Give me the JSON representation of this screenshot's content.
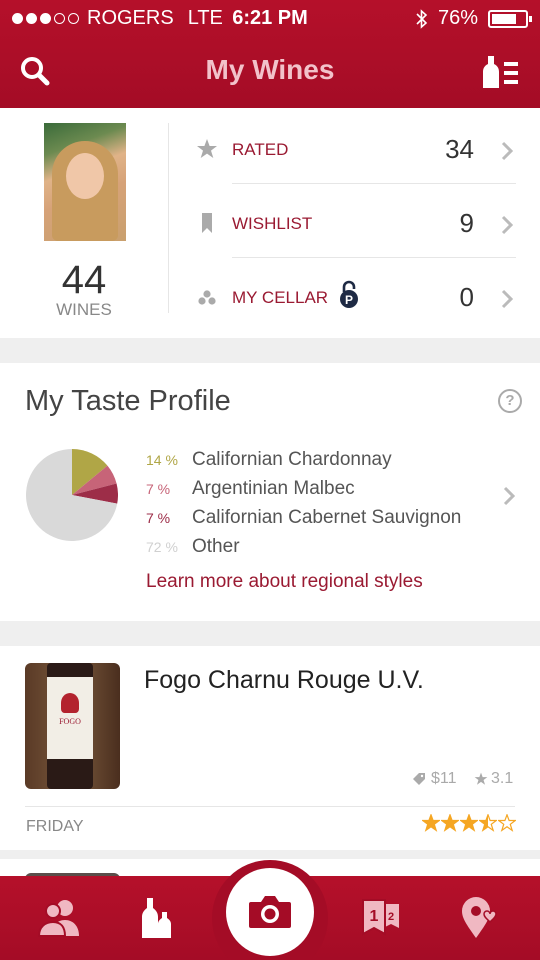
{
  "status_bar": {
    "carrier": "ROGERS",
    "network": "LTE",
    "time": "6:21 PM",
    "battery": "76%",
    "battery_level": 0.76,
    "signal_bars": 3,
    "signal_max": 5
  },
  "header": {
    "title": "My Wines",
    "left_icon": "search-icon",
    "right_icon": "wine-list-icon"
  },
  "profile": {
    "wine_count": "44",
    "wine_count_label": "WINES",
    "rows": [
      {
        "label": "RATED",
        "value": "34",
        "icon": "star-icon"
      },
      {
        "label": "WISHLIST",
        "value": "9",
        "icon": "bookmark-icon"
      },
      {
        "label": "MY CELLAR",
        "value": "0",
        "icon": "cellar-icon",
        "badge": "P"
      }
    ]
  },
  "taste_profile": {
    "title": "My Taste Profile",
    "help": "?",
    "items": [
      {
        "pct": "14 %",
        "name": "Californian Chardonnay",
        "color": "#b0a646"
      },
      {
        "pct": "7 %",
        "name": "Argentinian Malbec",
        "color": "#c76478"
      },
      {
        "pct": "7 %",
        "name": "Californian Cabernet Sauvignon",
        "color": "#9d2d48"
      },
      {
        "pct": "72 %",
        "name": "Other",
        "color": "#d9d9d9"
      }
    ],
    "learn_more": "Learn more about regional styles"
  },
  "wine_entry": {
    "name": "Fogo Charnu Rouge U.V.",
    "price": "$11",
    "avg_rating": "3.1",
    "day": "FRIDAY",
    "user_rating": 3.5,
    "label_text": "FOGO"
  },
  "tabbar": {
    "tabs": [
      "friends-icon",
      "wines-icon",
      "camera-icon",
      "rankings-icon",
      "places-icon"
    ]
  },
  "colors": {
    "brand": "#a40c26",
    "accent_text": "#9a1a32",
    "star": "#f5a623"
  }
}
